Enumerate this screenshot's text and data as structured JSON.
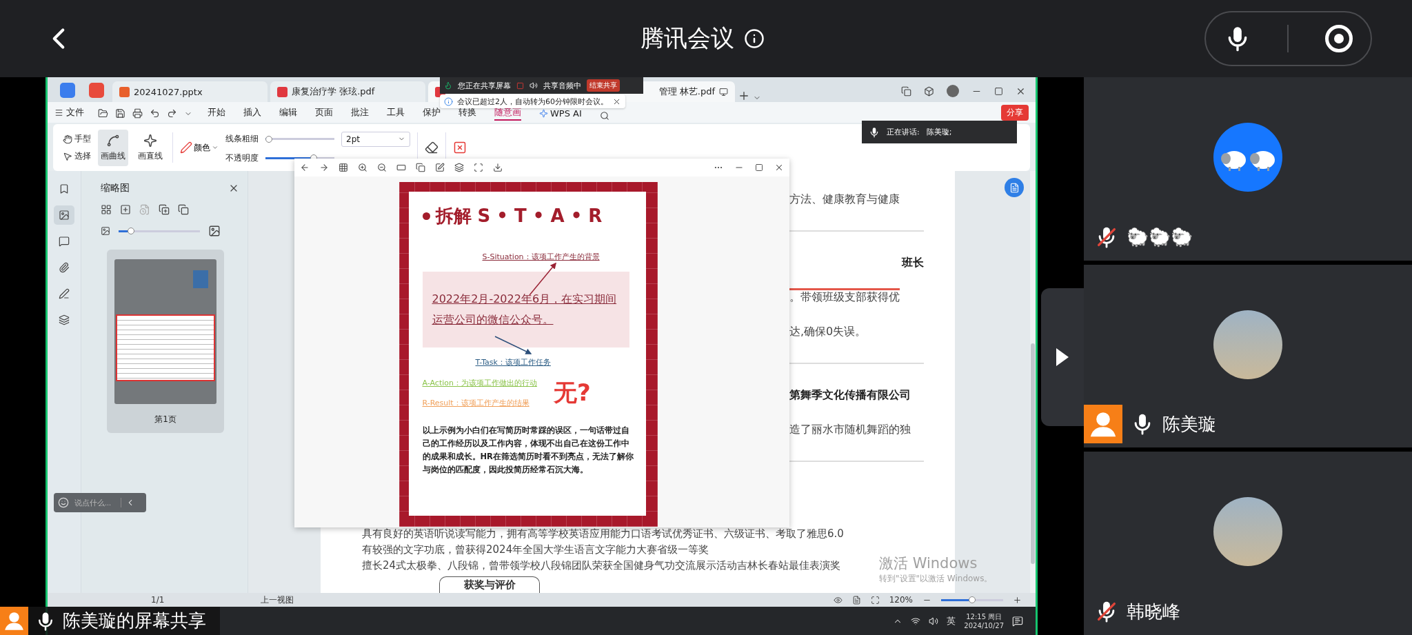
{
  "meeting": {
    "title": "腾讯会议"
  },
  "share_label": "陈美璇的屏幕共享",
  "share_bar": {
    "status": "您正在共享屏幕",
    "audio": "共享音频中",
    "stop": "结束共享",
    "notice": "会议已超过2人，自动转为60分钟限时会议。"
  },
  "speaking": {
    "label": "正在讲话:",
    "name": "陈美璇;"
  },
  "app": {
    "tabs": [
      {
        "label": "20241027.pptx",
        "kind": "pptx",
        "selected": false
      },
      {
        "label": "康复治疗学 张玹.pdf",
        "kind": "pdf",
        "selected": false
      },
      {
        "label": "管理 林艺.pdf",
        "kind": "pdf",
        "selected": true
      }
    ],
    "file_menu": "文件",
    "menu": [
      {
        "label": "开始",
        "selected": false
      },
      {
        "label": "插入",
        "selected": false
      },
      {
        "label": "编辑",
        "selected": false
      },
      {
        "label": "页面",
        "selected": false
      },
      {
        "label": "批注",
        "selected": false
      },
      {
        "label": "工具",
        "selected": false
      },
      {
        "label": "保护",
        "selected": false
      },
      {
        "label": "转换",
        "selected": false
      },
      {
        "label": "随意画",
        "selected": true
      },
      {
        "label": "WPS AI",
        "selected": false
      }
    ],
    "share_button": "分享",
    "tools": [
      {
        "label": "手型",
        "kind": "inline",
        "selected": false
      },
      {
        "label": "选择",
        "kind": "inline",
        "selected": false
      },
      {
        "label": "画曲线",
        "kind": "stacked",
        "selected": true
      },
      {
        "label": "画直线",
        "kind": "stacked",
        "selected": false
      }
    ],
    "color_label": "颜色",
    "thickness": {
      "label": "线条粗细",
      "level": 0.05,
      "value": "2pt"
    },
    "opacity": {
      "label": "不透明度",
      "level": 0.7
    },
    "rail": [
      {
        "kind": "bookmark",
        "selected": false
      },
      {
        "kind": "thumbnail",
        "selected": true
      },
      {
        "kind": "comment",
        "selected": false
      },
      {
        "kind": "attachment",
        "selected": false
      },
      {
        "kind": "sign",
        "selected": false
      },
      {
        "kind": "layers",
        "selected": false
      }
    ],
    "sidebar": {
      "title": "缩略图",
      "zoom": {
        "level": 0.15
      },
      "page_label": "第1页"
    },
    "chat": {
      "placeholder": "说点什么..."
    },
    "document": {
      "entries": [
        {
          "kind": "text",
          "text": "方法、健康教育与健康"
        },
        {
          "kind": "rule"
        },
        {
          "kind": "title",
          "text": "班长"
        },
        {
          "kind": "struck",
          "text": "。带领班级支部获得优"
        },
        {
          "kind": "text",
          "text": "达,确保0失误。"
        },
        {
          "kind": "rule"
        },
        {
          "kind": "bold",
          "text": "第舞季文化传播有限公司"
        },
        {
          "kind": "text",
          "text": "造了丽水市随机舞蹈的独"
        },
        {
          "kind": "rule"
        }
      ],
      "lines": [
        "具有良好的英语听说读写能力，拥有高等学校英语应用能力口语考试优秀证书、六级证书、考取了雅思6.0",
        "有较强的文字功底，曾获得2024年全国大学生语言文字能力大赛省级一等奖",
        "擅长24式太极拳、八段锦，曾带领学校八段锦团队荣获全国健身气功交流展示活动吉林长春站最佳表演奖"
      ],
      "section_button": "获奖与评价"
    },
    "viewer": {
      "title": "拆解 S • T • A • R",
      "situation": "S-Situation：该项工作产生的背景",
      "example": "2022年2月-2022年6月，在实习期间运营公司的微信公众号。",
      "task": "T-Task：该项工作任务",
      "steps": [
        {
          "text": "A-Action：为该项工作做出的行动",
          "color": "#8bc34a"
        },
        {
          "text": "R-Result：该项工作产生的结果",
          "color": "#f0a05a"
        }
      ],
      "verdict": "无?",
      "paragraph": "以上示例为小白们在写简历时常踩的误区，一句话带过自己的工作经历以及工作内容，体现不出自己在这份工作中的成果和成长。HR在筛选简历时看不到亮点，无法了解你与岗位的匹配度，因此投简历经常石沉大海。"
    },
    "status": {
      "page": "1/1",
      "prev_view": "上一视图",
      "zoom": {
        "value": "120%",
        "level": 0.5
      }
    },
    "watermark": {
      "title": "激活 Windows",
      "hint": "转到\"设置\"以激活 Windows。"
    },
    "taskbar": {
      "ime": "英",
      "time": "12:15 周日",
      "date": "2024/10/27"
    }
  },
  "participants": [
    {
      "name": "🐑🐑🐑",
      "kind": "sheep",
      "muted": true,
      "presenter": false
    },
    {
      "name": "陈美璇",
      "kind": "photo",
      "muted": false,
      "presenter": true
    },
    {
      "name": "韩晓峰",
      "kind": "photo",
      "muted": true,
      "presenter": false
    }
  ]
}
